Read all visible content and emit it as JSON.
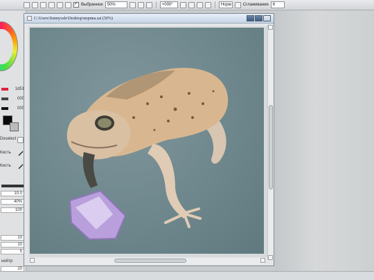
{
  "toolbar": {
    "stabilize_checkbox_label": "Выбранное",
    "zoom_value": "50%",
    "rotation_value": "+000°",
    "blend_mode": "Норм",
    "smoothing_label": "Сглаживание",
    "smoothing_value": "6"
  },
  "window": {
    "title": "C:\\Users\\Sunnyvale\\Desktop\\иорика.sai (50%)"
  },
  "palette": {
    "value_1": "1d51",
    "value_2": "000",
    "value_3": "000",
    "deselect_label": "Deselect",
    "tool_label_1": "Кисть",
    "tool_label_2": "Кисть",
    "size_value": "10.0",
    "density_value": "40%",
    "param_1": "100",
    "param_2": "10",
    "param_3": "10",
    "param_4": "5",
    "texture_label": "нейтр",
    "param_5": "20"
  },
  "colors": {
    "canvas_bg": "#6e878d",
    "titlebar": "#c6d5e6",
    "foreground_color": "#0a0a0a"
  },
  "icons": [
    "minimize-icon",
    "maximize-icon",
    "close-icon",
    "color-wheel",
    "brush-icon",
    "window-icon"
  ]
}
